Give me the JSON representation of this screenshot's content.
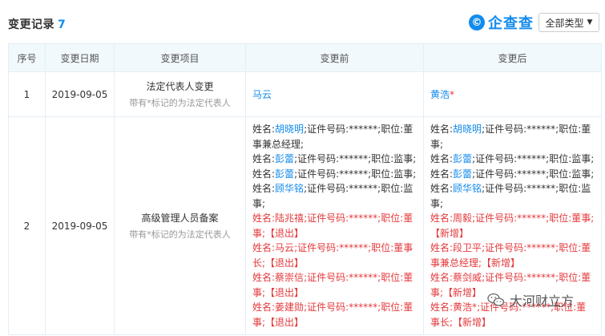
{
  "header": {
    "title": "变更记录",
    "count": "7",
    "logo_text": "企查查",
    "filter_label": "全部类型"
  },
  "table": {
    "columns": [
      "序号",
      "变更日期",
      "变更项目",
      "变更前",
      "变更后"
    ],
    "rows": [
      {
        "index": "1",
        "date": "2019-09-05",
        "item": "法定代表人变更",
        "note": "带有*标记的为法定代表人",
        "before": "马云",
        "after_name": "黄浩",
        "after_mark": "*"
      },
      {
        "index": "2",
        "date": "2019-09-05",
        "item": "高级管理人员备案",
        "note": "带有*标记的为法定代表人",
        "before": [
          {
            "prefix": "姓名:",
            "name": "胡晓明",
            "rest": ";证件号码:******;职位:董事兼总经理;"
          },
          {
            "prefix": "姓名:",
            "name": "彭蕾",
            "rest": ";证件号码:******;职位:监事;"
          },
          {
            "prefix": "姓名:",
            "name": "彭蕾",
            "rest": ";证件号码:******;职位:监事;"
          },
          {
            "prefix": "姓名:",
            "name": "顾华铭",
            "rest": ";证件号码:******;职位:监事;"
          },
          {
            "prefix": "姓名:",
            "name": "陆兆禧",
            "rest": ";证件号码:******;职位:董事;【退出】",
            "red": true
          },
          {
            "prefix": "姓名:",
            "name": "马云",
            "rest": ";证件号码:******;职位:董事长;【退出】",
            "red": true
          },
          {
            "prefix": "姓名:",
            "name": "蔡崇信",
            "rest": ";证件号码:******;职位:董事;【退出】",
            "red": true
          },
          {
            "prefix": "姓名:",
            "name": "姜建勋",
            "rest": ";证件号码:******;职位:董事;【退出】",
            "red": true
          }
        ],
        "after": [
          {
            "prefix": "姓名:",
            "name": "胡晓明",
            "rest": ";证件号码:******;职位:董事;"
          },
          {
            "prefix": "姓名:",
            "name": "彭蕾",
            "rest": ";证件号码:******;职位:监事;"
          },
          {
            "prefix": "姓名:",
            "name": "彭蕾",
            "rest": ";证件号码:******;职位:监事;"
          },
          {
            "prefix": "姓名:",
            "name": "顾华铭",
            "rest": ";证件号码:******;职位:监事;"
          },
          {
            "prefix": "姓名:",
            "name": "周毅",
            "rest": ";证件号码:******;职位:董事;【新增】",
            "red": true
          },
          {
            "prefix": "姓名:",
            "name": "段卫平",
            "rest": ";证件号码:******;职位:董事兼总经理;【新增】",
            "red": true
          },
          {
            "prefix": "姓名:",
            "name": "蔡剑威",
            "rest": ";证件号码:******;职位:董事;【新增】",
            "red": true
          },
          {
            "prefix": "姓名:",
            "name": "黄浩*",
            "rest": ";证件号码:******;职位:董事长;【新增】",
            "red": true
          }
        ]
      }
    ]
  },
  "watermark": {
    "text": "大河财立方",
    "icon": "wechat-icon"
  }
}
